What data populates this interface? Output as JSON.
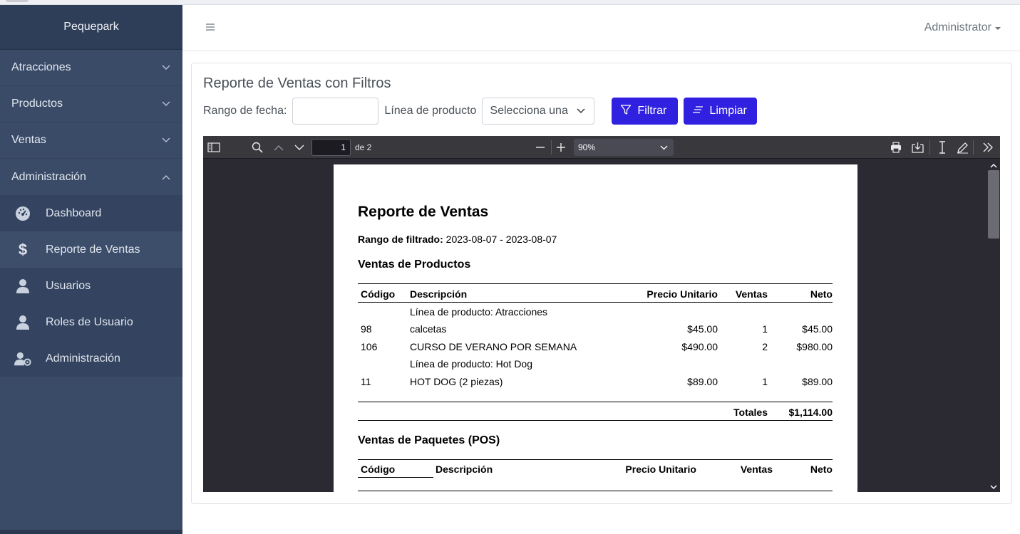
{
  "app": {
    "brand": "Pequepark",
    "user_menu": "Administrator"
  },
  "sidebar": {
    "groups": [
      {
        "label": "Atracciones",
        "expanded": false
      },
      {
        "label": "Productos",
        "expanded": false
      },
      {
        "label": "Ventas",
        "expanded": false
      },
      {
        "label": "Administración",
        "expanded": true
      }
    ],
    "admin_items": [
      {
        "label": "Dashboard",
        "icon": "dashboard-gauge-icon",
        "active": false
      },
      {
        "label": "Reporte de Ventas",
        "icon": "dollar-icon",
        "active": true
      },
      {
        "label": "Usuarios",
        "icon": "user-icon",
        "active": false
      },
      {
        "label": "Roles de Usuario",
        "icon": "user-icon",
        "active": false
      },
      {
        "label": "Administración",
        "icon": "user-gear-icon",
        "active": false
      }
    ]
  },
  "card": {
    "title": "Reporte de Ventas con Filtros",
    "date_label": "Rango de fecha:",
    "date_value": "",
    "line_label": "Línea de producto",
    "line_select": "Selecciona una",
    "filter_button": "Filtrar",
    "clear_button": "Limpiar",
    "accent_color": "#3020e0"
  },
  "pdf_viewer": {
    "page_number": "1",
    "page_of": "de 2",
    "zoom": "90%",
    "document": {
      "title": "Reporte de Ventas",
      "range_label": "Rango de filtrado:",
      "range_value": "2023-08-07 - 2023-08-07",
      "section1": "Ventas de Productos",
      "headers": [
        "Código",
        "Descripción",
        "Precio Unitario",
        "Ventas",
        "Neto"
      ],
      "rows": [
        {
          "code": "",
          "desc": "Línea de producto: Atracciones",
          "price": "",
          "sales": "",
          "net": ""
        },
        {
          "code": "98",
          "desc": "calcetas",
          "price": "$45.00",
          "sales": "1",
          "net": "$45.00"
        },
        {
          "code": "106",
          "desc": "CURSO DE VERANO POR SEMANA",
          "price": "$490.00",
          "sales": "2",
          "net": "$980.00"
        },
        {
          "code": "",
          "desc": "Línea de producto: Hot Dog",
          "price": "",
          "sales": "",
          "net": ""
        },
        {
          "code": "11",
          "desc": "HOT DOG (2 piezas)",
          "price": "$89.00",
          "sales": "1",
          "net": "$89.00"
        }
      ],
      "totals_label": "Totales",
      "totals_value": "$1,114.00",
      "section2": "Ventas de Paquetes (POS)",
      "headers2": [
        "Código",
        "Descripción",
        "Precio Unitario",
        "Ventas",
        "Neto"
      ]
    }
  }
}
